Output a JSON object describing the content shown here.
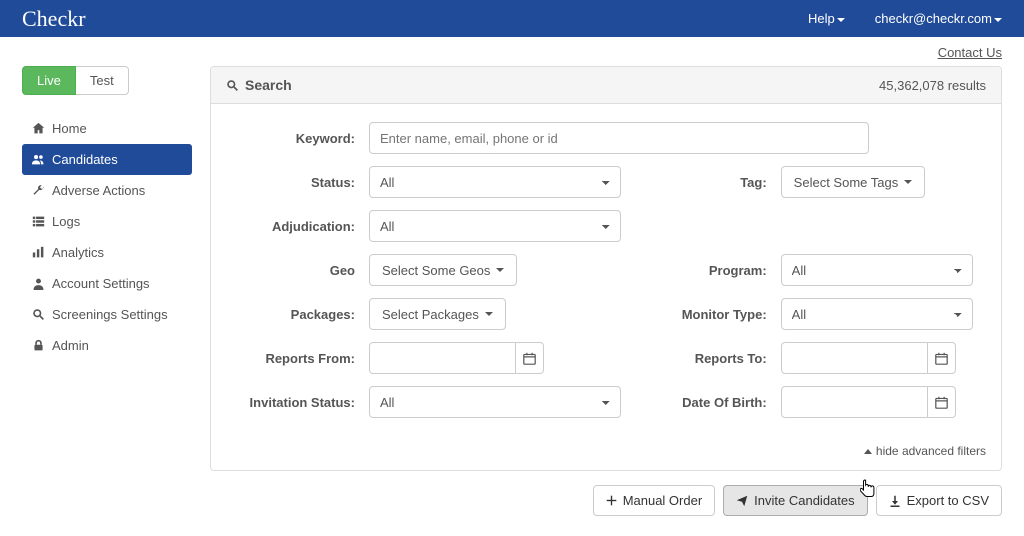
{
  "header": {
    "brand": "Checkr",
    "help": "Help",
    "user": "checkr@checkr.com",
    "contact_us": "Contact Us"
  },
  "env": {
    "live": "Live",
    "test": "Test"
  },
  "sidebar": {
    "items": [
      {
        "label": "Home"
      },
      {
        "label": "Candidates"
      },
      {
        "label": "Adverse Actions"
      },
      {
        "label": "Logs"
      },
      {
        "label": "Analytics"
      },
      {
        "label": "Account Settings"
      },
      {
        "label": "Screenings Settings"
      },
      {
        "label": "Admin"
      }
    ]
  },
  "search": {
    "title": "Search",
    "results": "45,362,078 results",
    "labels": {
      "keyword": "Keyword:",
      "status": "Status:",
      "tag": "Tag:",
      "adjudication": "Adjudication:",
      "geo": "Geo",
      "program": "Program:",
      "packages": "Packages:",
      "monitor_type": "Monitor Type:",
      "reports_from": "Reports From:",
      "reports_to": "Reports To:",
      "invitation_status": "Invitation Status:",
      "date_of_birth": "Date Of Birth:"
    },
    "placeholders": {
      "keyword": "Enter name, email, phone or id"
    },
    "values": {
      "status": "All",
      "adjudication": "All",
      "geos": "Select Some Geos",
      "packages": "Select Packages",
      "invitation_status": "All",
      "tags": "Select Some Tags",
      "program": "All",
      "monitor_type": "All"
    },
    "hide_filters": "hide advanced filters"
  },
  "actions": {
    "manual_order": "Manual Order",
    "invite_candidates": "Invite Candidates",
    "export_csv": "Export to CSV"
  }
}
